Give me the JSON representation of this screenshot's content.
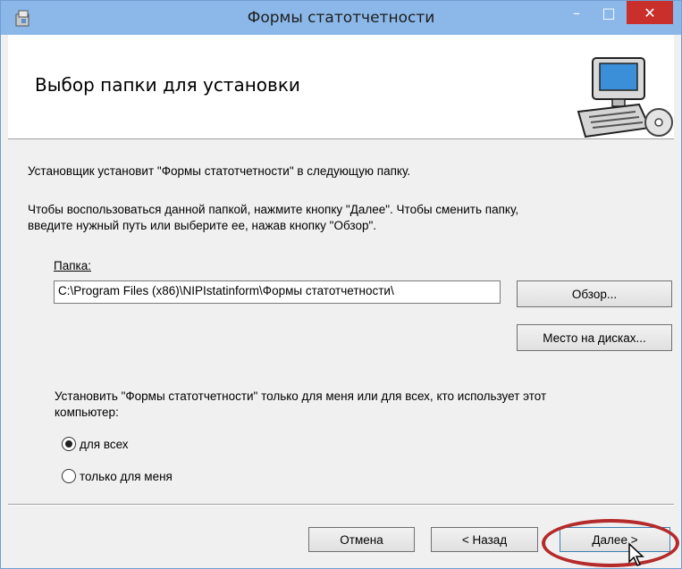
{
  "window": {
    "title": "Формы статотчетности",
    "minimize": "–",
    "maximize": "□",
    "close": "✕"
  },
  "header": {
    "title": "Выбор папки для установки"
  },
  "body": {
    "line1": "Установщик установит \"Формы статотчетности\" в следующую папку.",
    "line2a": "Чтобы воспользоваться данной папкой, нажмите кнопку \"Далее\". Чтобы сменить папку,",
    "line2b": "введите нужный путь или выберите ее, нажав кнопку \"Обзор\".",
    "folder_label": "Папка:",
    "folder_value": "C:\\Program Files (x86)\\NIPIstatinform\\Формы статотчетности\\",
    "browse_label": "Обзор...",
    "disk_label": "Место на дисках...",
    "install_for_a": "Установить \"Формы статотчетности\" только для меня или для всех, кто использует этот",
    "install_for_b": "компьютер:",
    "radio_all": "для всех",
    "radio_me": "только для меня"
  },
  "footer": {
    "cancel": "Отмена",
    "back": "< Назад",
    "next": "Далее >"
  },
  "colors": {
    "titlebar": "#8bb8e8",
    "close": "#c9302c",
    "highlight_ring": "#b52b2b"
  }
}
